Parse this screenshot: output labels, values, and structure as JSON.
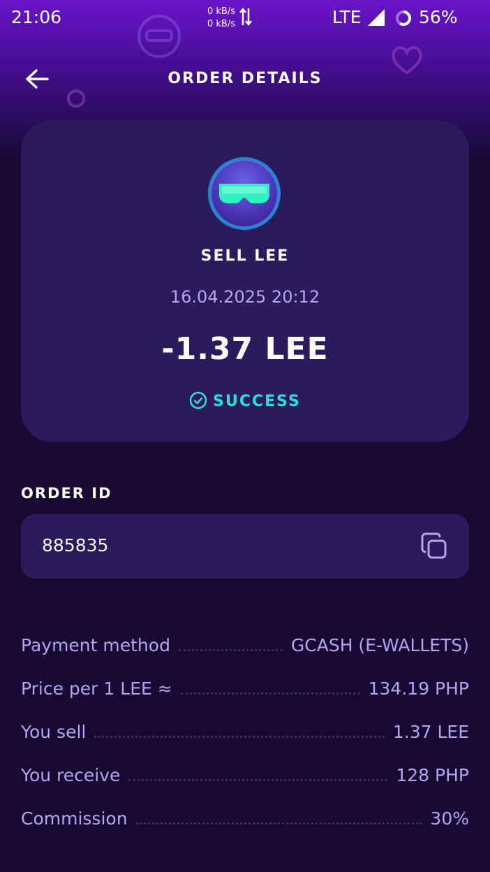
{
  "status_bar": {
    "time": "21:06",
    "net_up": "0 kB/s",
    "net_down": "0 kB/s",
    "network": "LTE",
    "battery": "56%"
  },
  "header": {
    "title": "ORDER DETAILS",
    "back_icon": "arrow-left-icon"
  },
  "card": {
    "coin_icon": "goggles-coin-icon",
    "title": "SELL LEE",
    "datetime": "16.04.2025 20:12",
    "amount": "-1.37 LEE",
    "status": "SUCCESS",
    "status_icon": "check-circle-icon",
    "status_color": "#2de0d4"
  },
  "order": {
    "label": "ORDER ID",
    "id": "885835",
    "copy_icon": "copy-icon"
  },
  "details": [
    {
      "label": "Payment method",
      "value": "GCASH (E-WALLETS)"
    },
    {
      "label": "Price per 1 LEE ≈",
      "value": "134.19 PHP"
    },
    {
      "label": "You sell",
      "value": "1.37 LEE"
    },
    {
      "label": "You receive",
      "value": "128 PHP"
    },
    {
      "label": "Commission",
      "value": "30%"
    }
  ],
  "colors": {
    "background": "#170932",
    "card": "#2b1a5c",
    "accent_text": "#b3a6f0",
    "header_purple": "#6a14c9"
  }
}
